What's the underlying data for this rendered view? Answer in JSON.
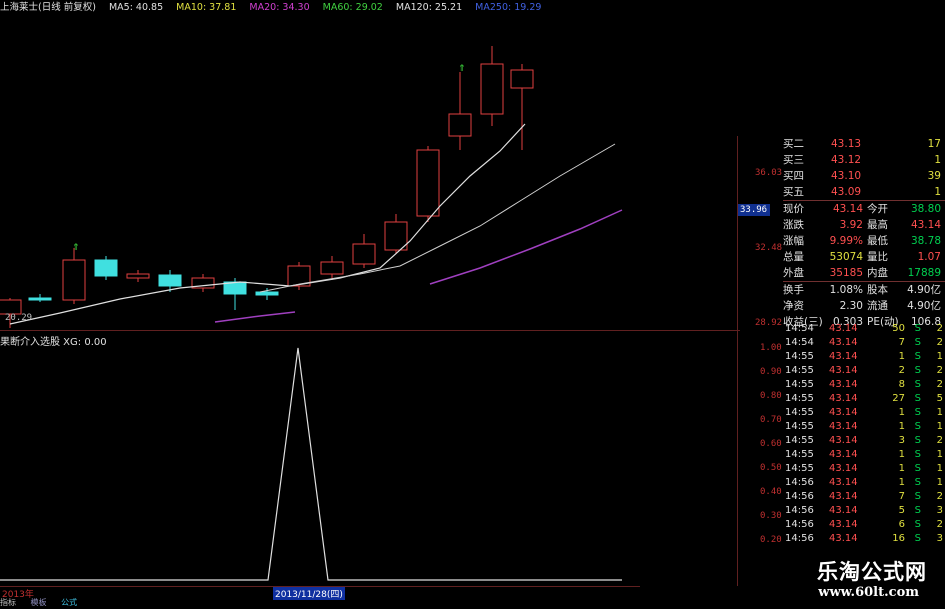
{
  "header": {
    "stock_name": "上海莱士(日线 前复权)",
    "ma5": "MA5: 40.85",
    "ma10": "MA10: 37.81",
    "ma20": "MA20: 34.30",
    "ma60": "MA60: 29.02",
    "ma120": "MA120: 25.21",
    "ma250": "MA250: 19.29"
  },
  "price_axis": {
    "labels": [
      "36.03",
      "32.48",
      "28.92"
    ],
    "current_box": "33.96",
    "low_marker": "20.29"
  },
  "indicator": {
    "title": "果断介入选股 XG: 0.00",
    "axis_labels": [
      "1.00",
      "0.90",
      "0.80",
      "0.70",
      "0.60",
      "0.50",
      "0.40",
      "0.30",
      "0.20"
    ]
  },
  "quote": {
    "bid_rows": [
      {
        "label": "买二",
        "price": "43.13",
        "vol": "17"
      },
      {
        "label": "买三",
        "price": "43.12",
        "vol": "1"
      },
      {
        "label": "买四",
        "price": "43.10",
        "vol": "39"
      },
      {
        "label": "买五",
        "price": "43.09",
        "vol": "1"
      }
    ],
    "stats": [
      {
        "l1": "现价",
        "v1": "43.14",
        "l2": "今开",
        "v2": "38.80"
      },
      {
        "l1": "涨跌",
        "v1": "3.92",
        "l2": "最高",
        "v2": "43.14"
      },
      {
        "l1": "涨幅",
        "v1": "9.99%",
        "l2": "最低",
        "v2": "38.78"
      },
      {
        "l1": "总量",
        "v1": "53074",
        "l2": "量比",
        "v2": "1.07"
      },
      {
        "l1": "外盘",
        "v1": "35185",
        "l2": "内盘",
        "v2": "17889"
      }
    ],
    "stats2": [
      {
        "l1": "换手",
        "v1": "1.08%",
        "l2": "股本",
        "v2": "4.90亿"
      },
      {
        "l1": "净资",
        "v1": "2.30",
        "l2": "流通",
        "v2": "4.90亿"
      },
      {
        "l1": "收益(三)",
        "v1": "0.303",
        "l2": "PE(动)",
        "v2": "106.8"
      }
    ]
  },
  "ticks": [
    {
      "time": "14:54",
      "price": "43.14",
      "vol": "50",
      "dir": "S",
      "n": "2"
    },
    {
      "time": "14:54",
      "price": "43.14",
      "vol": "7",
      "dir": "S",
      "n": "2"
    },
    {
      "time": "14:55",
      "price": "43.14",
      "vol": "1",
      "dir": "S",
      "n": "1"
    },
    {
      "time": "14:55",
      "price": "43.14",
      "vol": "2",
      "dir": "S",
      "n": "2"
    },
    {
      "time": "14:55",
      "price": "43.14",
      "vol": "8",
      "dir": "S",
      "n": "2"
    },
    {
      "time": "14:55",
      "price": "43.14",
      "vol": "27",
      "dir": "S",
      "n": "5"
    },
    {
      "time": "14:55",
      "price": "43.14",
      "vol": "1",
      "dir": "S",
      "n": "1"
    },
    {
      "time": "14:55",
      "price": "43.14",
      "vol": "1",
      "dir": "S",
      "n": "1"
    },
    {
      "time": "14:55",
      "price": "43.14",
      "vol": "3",
      "dir": "S",
      "n": "2"
    },
    {
      "time": "14:55",
      "price": "43.14",
      "vol": "1",
      "dir": "S",
      "n": "1"
    },
    {
      "time": "14:55",
      "price": "43.14",
      "vol": "1",
      "dir": "S",
      "n": "1"
    },
    {
      "time": "14:56",
      "price": "43.14",
      "vol": "1",
      "dir": "S",
      "n": "1"
    },
    {
      "time": "14:56",
      "price": "43.14",
      "vol": "7",
      "dir": "S",
      "n": "2"
    },
    {
      "time": "14:56",
      "price": "43.14",
      "vol": "5",
      "dir": "S",
      "n": "3"
    },
    {
      "time": "14:56",
      "price": "43.14",
      "vol": "6",
      "dir": "S",
      "n": "2"
    },
    {
      "time": "14:56",
      "price": "43.14",
      "vol": "16",
      "dir": "S",
      "n": "3"
    }
  ],
  "footer": {
    "year": "2013年",
    "cursor_date": "2013/11/28(四)",
    "tab_first": "指标",
    "tab_second": "模板",
    "tabs_label": "公式"
  },
  "watermark": {
    "title": "乐淘公式网",
    "url": "www.60lt.com"
  },
  "colors": {
    "up": "#e04040",
    "down": "#40e0e0",
    "ma_white": "#e0e0e0",
    "ma_purple": "#a040c0",
    "axis_red": "#c03030"
  }
}
